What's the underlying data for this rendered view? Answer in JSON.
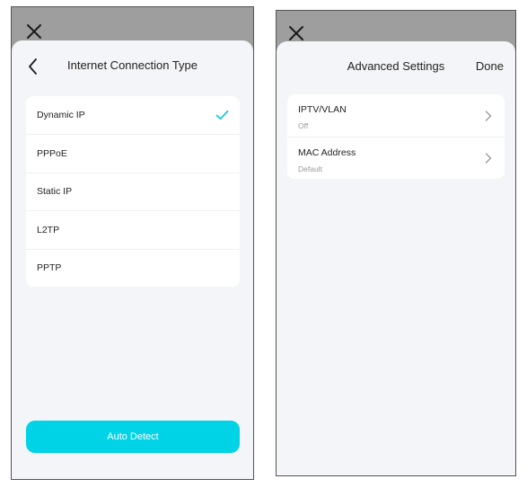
{
  "left_screen": {
    "title": "Internet Connection Type",
    "options": [
      {
        "label": "Dynamic IP",
        "selected": true
      },
      {
        "label": "PPPoE",
        "selected": false
      },
      {
        "label": "Static IP",
        "selected": false
      },
      {
        "label": "L2TP",
        "selected": false
      },
      {
        "label": "PPTP",
        "selected": false
      }
    ],
    "auto_detect_label": "Auto Detect",
    "icons": [
      "close-icon",
      "back-chevron-icon",
      "checkmark-icon"
    ]
  },
  "right_screen": {
    "title": "Advanced Settings",
    "done_label": "Done",
    "items": [
      {
        "title": "IPTV/VLAN",
        "value": "Off"
      },
      {
        "title": "MAC Address",
        "value": "Default"
      }
    ],
    "icons": [
      "close-icon",
      "chevron-right-icon"
    ]
  },
  "colors": {
    "accent": "#00d3e6",
    "check": "#1ec6d8",
    "backdrop": "#9e9e9e",
    "sheet": "#f4f5f8",
    "card": "#ffffff"
  }
}
